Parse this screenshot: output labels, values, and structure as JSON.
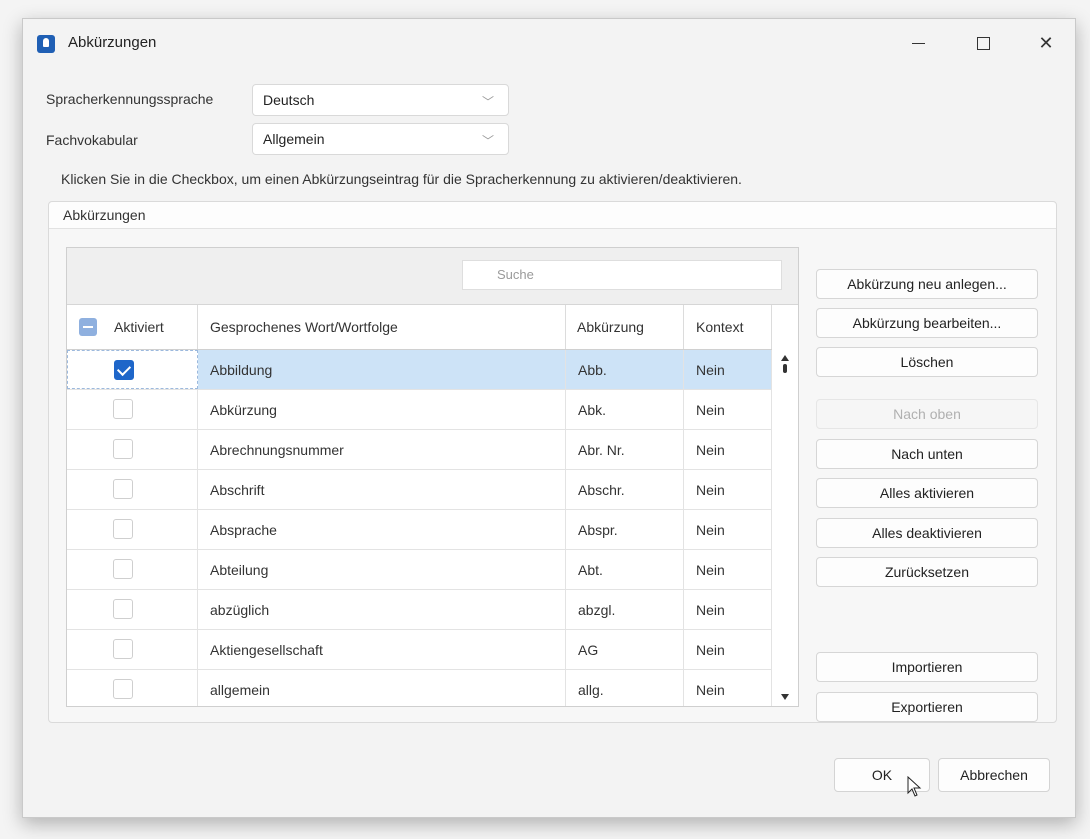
{
  "window": {
    "title": "Abkürzungen"
  },
  "form": {
    "language_label": "Spracherkennungssprache",
    "language_value": "Deutsch",
    "vocab_label": "Fachvokabular",
    "vocab_value": "Allgemein",
    "hint": "Klicken Sie in die Checkbox, um einen Abkürzungseintrag für die Spracherkennung zu aktivieren/deaktivieren."
  },
  "group": {
    "title": "Abkürzungen"
  },
  "table": {
    "search_placeholder": "Suche",
    "headers": [
      "Aktiviert",
      "Gesprochenes Wort/Wortfolge",
      "Abkürzung",
      "Kontext"
    ],
    "rows": [
      {
        "active": true,
        "word": "Abbildung",
        "abbr": "Abb.",
        "context": "Nein"
      },
      {
        "active": false,
        "word": "Abkürzung",
        "abbr": "Abk.",
        "context": "Nein"
      },
      {
        "active": false,
        "word": "Abrechnungsnummer",
        "abbr": "Abr. Nr.",
        "context": "Nein"
      },
      {
        "active": false,
        "word": "Abschrift",
        "abbr": "Abschr.",
        "context": "Nein"
      },
      {
        "active": false,
        "word": "Absprache",
        "abbr": "Abspr.",
        "context": "Nein"
      },
      {
        "active": false,
        "word": "Abteilung",
        "abbr": "Abt.",
        "context": "Nein"
      },
      {
        "active": false,
        "word": "abzüglich",
        "abbr": "abzgl.",
        "context": "Nein"
      },
      {
        "active": false,
        "word": "Aktiengesellschaft",
        "abbr": "AG",
        "context": "Nein"
      },
      {
        "active": false,
        "word": "allgemein",
        "abbr": "allg.",
        "context": "Nein"
      }
    ]
  },
  "side_buttons": {
    "new": "Abkürzung neu anlegen...",
    "edit": "Abkürzung bearbeiten...",
    "delete": "Löschen",
    "up": "Nach oben",
    "down": "Nach unten",
    "enable_all": "Alles aktivieren",
    "disable_all": "Alles deaktivieren",
    "reset": "Zurücksetzen",
    "import": "Importieren",
    "export": "Exportieren"
  },
  "dialog": {
    "ok": "OK",
    "cancel": "Abbrechen"
  },
  "colors": {
    "accent": "#1e66c9",
    "selected_row": "#cde3f7"
  }
}
